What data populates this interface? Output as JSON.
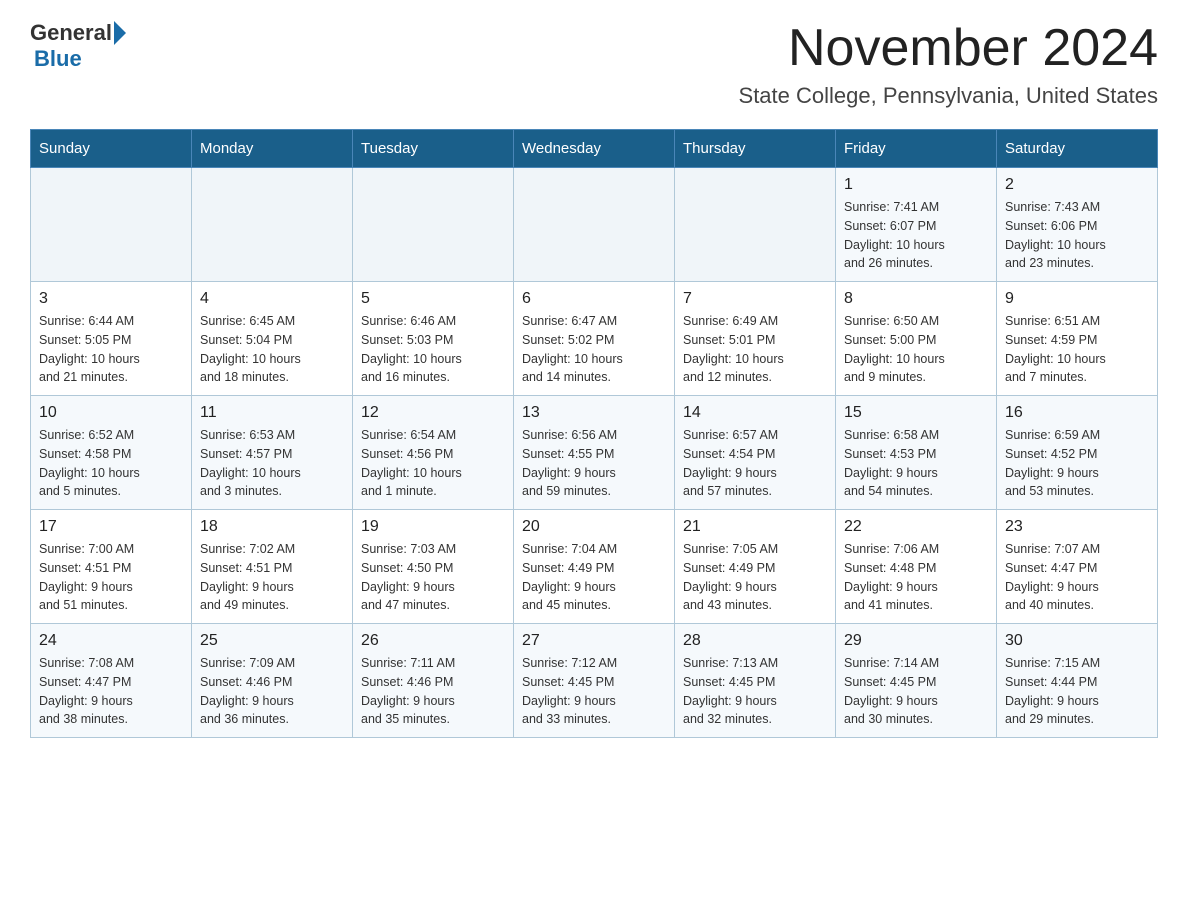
{
  "logo": {
    "general": "General",
    "blue": "Blue"
  },
  "header": {
    "month_year": "November 2024",
    "location": "State College, Pennsylvania, United States"
  },
  "calendar": {
    "days_of_week": [
      "Sunday",
      "Monday",
      "Tuesday",
      "Wednesday",
      "Thursday",
      "Friday",
      "Saturday"
    ],
    "weeks": [
      [
        {
          "day": "",
          "info": ""
        },
        {
          "day": "",
          "info": ""
        },
        {
          "day": "",
          "info": ""
        },
        {
          "day": "",
          "info": ""
        },
        {
          "day": "",
          "info": ""
        },
        {
          "day": "1",
          "info": "Sunrise: 7:41 AM\nSunset: 6:07 PM\nDaylight: 10 hours\nand 26 minutes."
        },
        {
          "day": "2",
          "info": "Sunrise: 7:43 AM\nSunset: 6:06 PM\nDaylight: 10 hours\nand 23 minutes."
        }
      ],
      [
        {
          "day": "3",
          "info": "Sunrise: 6:44 AM\nSunset: 5:05 PM\nDaylight: 10 hours\nand 21 minutes."
        },
        {
          "day": "4",
          "info": "Sunrise: 6:45 AM\nSunset: 5:04 PM\nDaylight: 10 hours\nand 18 minutes."
        },
        {
          "day": "5",
          "info": "Sunrise: 6:46 AM\nSunset: 5:03 PM\nDaylight: 10 hours\nand 16 minutes."
        },
        {
          "day": "6",
          "info": "Sunrise: 6:47 AM\nSunset: 5:02 PM\nDaylight: 10 hours\nand 14 minutes."
        },
        {
          "day": "7",
          "info": "Sunrise: 6:49 AM\nSunset: 5:01 PM\nDaylight: 10 hours\nand 12 minutes."
        },
        {
          "day": "8",
          "info": "Sunrise: 6:50 AM\nSunset: 5:00 PM\nDaylight: 10 hours\nand 9 minutes."
        },
        {
          "day": "9",
          "info": "Sunrise: 6:51 AM\nSunset: 4:59 PM\nDaylight: 10 hours\nand 7 minutes."
        }
      ],
      [
        {
          "day": "10",
          "info": "Sunrise: 6:52 AM\nSunset: 4:58 PM\nDaylight: 10 hours\nand 5 minutes."
        },
        {
          "day": "11",
          "info": "Sunrise: 6:53 AM\nSunset: 4:57 PM\nDaylight: 10 hours\nand 3 minutes."
        },
        {
          "day": "12",
          "info": "Sunrise: 6:54 AM\nSunset: 4:56 PM\nDaylight: 10 hours\nand 1 minute."
        },
        {
          "day": "13",
          "info": "Sunrise: 6:56 AM\nSunset: 4:55 PM\nDaylight: 9 hours\nand 59 minutes."
        },
        {
          "day": "14",
          "info": "Sunrise: 6:57 AM\nSunset: 4:54 PM\nDaylight: 9 hours\nand 57 minutes."
        },
        {
          "day": "15",
          "info": "Sunrise: 6:58 AM\nSunset: 4:53 PM\nDaylight: 9 hours\nand 54 minutes."
        },
        {
          "day": "16",
          "info": "Sunrise: 6:59 AM\nSunset: 4:52 PM\nDaylight: 9 hours\nand 53 minutes."
        }
      ],
      [
        {
          "day": "17",
          "info": "Sunrise: 7:00 AM\nSunset: 4:51 PM\nDaylight: 9 hours\nand 51 minutes."
        },
        {
          "day": "18",
          "info": "Sunrise: 7:02 AM\nSunset: 4:51 PM\nDaylight: 9 hours\nand 49 minutes."
        },
        {
          "day": "19",
          "info": "Sunrise: 7:03 AM\nSunset: 4:50 PM\nDaylight: 9 hours\nand 47 minutes."
        },
        {
          "day": "20",
          "info": "Sunrise: 7:04 AM\nSunset: 4:49 PM\nDaylight: 9 hours\nand 45 minutes."
        },
        {
          "day": "21",
          "info": "Sunrise: 7:05 AM\nSunset: 4:49 PM\nDaylight: 9 hours\nand 43 minutes."
        },
        {
          "day": "22",
          "info": "Sunrise: 7:06 AM\nSunset: 4:48 PM\nDaylight: 9 hours\nand 41 minutes."
        },
        {
          "day": "23",
          "info": "Sunrise: 7:07 AM\nSunset: 4:47 PM\nDaylight: 9 hours\nand 40 minutes."
        }
      ],
      [
        {
          "day": "24",
          "info": "Sunrise: 7:08 AM\nSunset: 4:47 PM\nDaylight: 9 hours\nand 38 minutes."
        },
        {
          "day": "25",
          "info": "Sunrise: 7:09 AM\nSunset: 4:46 PM\nDaylight: 9 hours\nand 36 minutes."
        },
        {
          "day": "26",
          "info": "Sunrise: 7:11 AM\nSunset: 4:46 PM\nDaylight: 9 hours\nand 35 minutes."
        },
        {
          "day": "27",
          "info": "Sunrise: 7:12 AM\nSunset: 4:45 PM\nDaylight: 9 hours\nand 33 minutes."
        },
        {
          "day": "28",
          "info": "Sunrise: 7:13 AM\nSunset: 4:45 PM\nDaylight: 9 hours\nand 32 minutes."
        },
        {
          "day": "29",
          "info": "Sunrise: 7:14 AM\nSunset: 4:45 PM\nDaylight: 9 hours\nand 30 minutes."
        },
        {
          "day": "30",
          "info": "Sunrise: 7:15 AM\nSunset: 4:44 PM\nDaylight: 9 hours\nand 29 minutes."
        }
      ]
    ]
  }
}
